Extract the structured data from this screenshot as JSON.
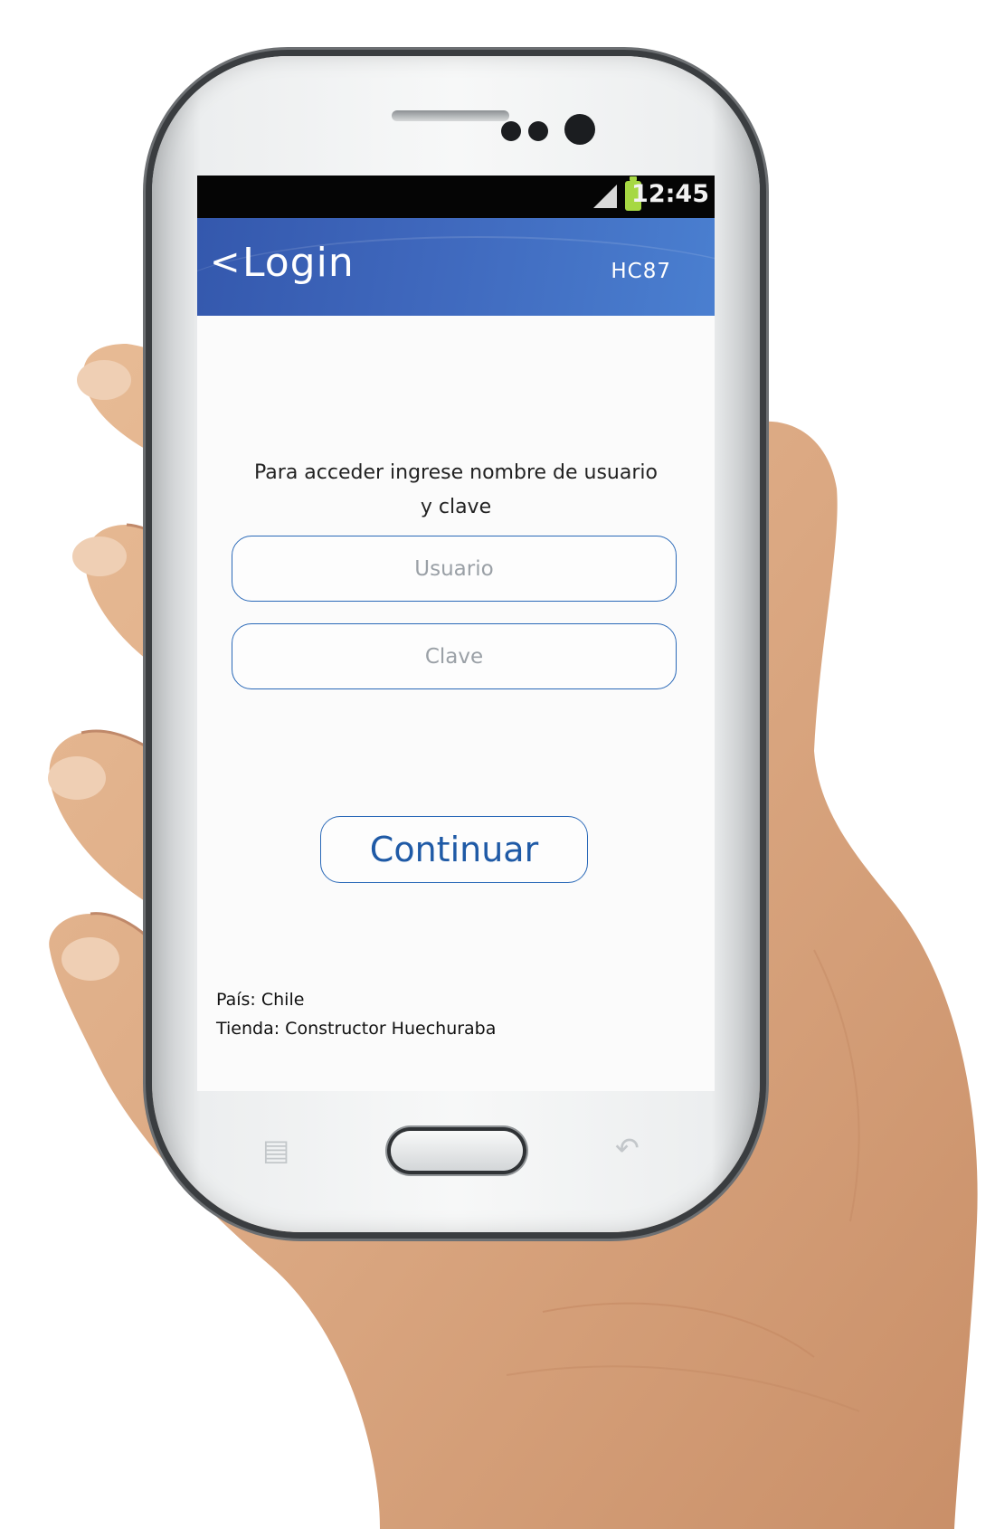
{
  "status_bar": {
    "time": "12:45",
    "signal_icon": "signal-icon",
    "battery_icon": "battery-icon"
  },
  "app_bar": {
    "back_icon": "<",
    "title": "Login",
    "store_code": "HC87"
  },
  "login": {
    "instructions_line1": "Para acceder ingrese nombre de usuario",
    "instructions_line2": "y clave",
    "username_placeholder": "Usuario",
    "password_placeholder": "Clave",
    "continue_label": "Continuar"
  },
  "footer": {
    "country": "País: Chile",
    "store": "Tienda: Constructor Huechuraba"
  },
  "device_keys": {
    "menu_icon": "menu-icon",
    "back_key_icon": "back-arrow-icon"
  },
  "colors": {
    "accent": "#2a69b8",
    "app_bar": "#3f68bd",
    "battery": "#a6d843"
  }
}
